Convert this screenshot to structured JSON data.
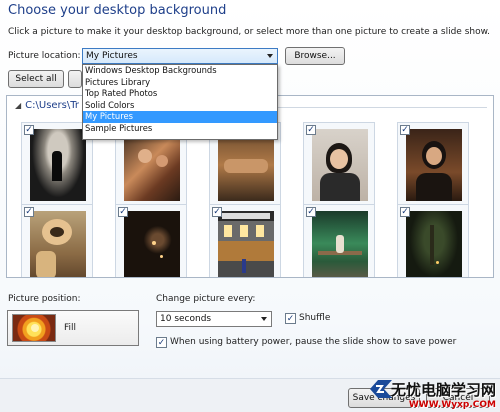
{
  "header": {
    "title": "Choose your desktop background",
    "subtitle": "Click a picture to make it your desktop background, or select more than one picture to create a slide show."
  },
  "location": {
    "label": "Picture location:",
    "selected": "My Pictures",
    "browse_label": "Browse...",
    "options": [
      "Windows Desktop Backgrounds",
      "Pictures Library",
      "Top Rated Photos",
      "Solid Colors",
      "My Pictures",
      "Sample Pictures"
    ],
    "selected_index": 4
  },
  "toolbar": {
    "select_all_label": "Select all"
  },
  "gallery": {
    "group_path": "C:\\Users\\Tr",
    "items": [
      {
        "scene": "silhouette-dark",
        "checked": true
      },
      {
        "scene": "people-indoor",
        "checked": true
      },
      {
        "scene": "crowd-indoor",
        "checked": true
      },
      {
        "scene": "woman-smiling",
        "checked": true
      },
      {
        "scene": "woman-restaurant",
        "checked": true
      },
      {
        "scene": "hand-closeup",
        "checked": true
      },
      {
        "scene": "night-dark",
        "checked": true
      },
      {
        "scene": "street-storefront",
        "checked": true
      },
      {
        "scene": "green-stage",
        "checked": true
      },
      {
        "scene": "night-tree",
        "checked": true
      }
    ]
  },
  "position": {
    "label": "Picture position:",
    "value": "Fill"
  },
  "interval": {
    "label": "Change picture every:",
    "value": "10 seconds"
  },
  "shuffle": {
    "label": "Shuffle",
    "checked": true
  },
  "battery": {
    "label": "When using battery power, pause the slide show to save power",
    "checked": true
  },
  "footer": {
    "save_label": "Save changes",
    "cancel_label": "Cancel"
  },
  "watermark": {
    "line1": "无忧电脑学习网",
    "line2": "WWW.Wyxp.COM"
  }
}
